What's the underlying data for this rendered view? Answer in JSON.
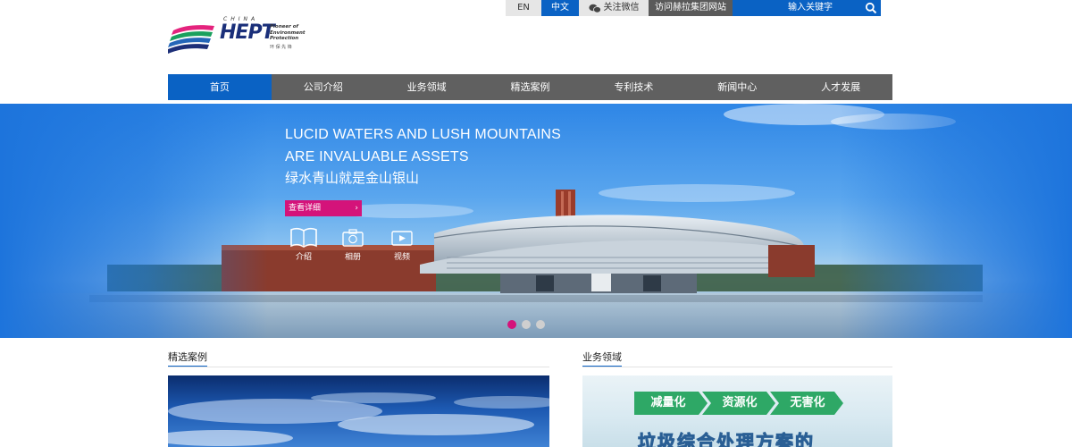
{
  "topbar": {
    "lang_en": "EN",
    "lang_zh": "中文",
    "wechat": "关注微信",
    "visit_group": "访问赫拉集团网站",
    "search_placeholder": "输入关键字"
  },
  "logo": {
    "country": "CHINA",
    "brand": "HEPT",
    "tagline_1": "Pioneer of",
    "tagline_2": "Environment Protection",
    "cn_name": "环 保 先 锋"
  },
  "nav": [
    {
      "label": "首页",
      "active": true
    },
    {
      "label": "公司介绍",
      "active": false
    },
    {
      "label": "业务领域",
      "active": false
    },
    {
      "label": "精选案例",
      "active": false
    },
    {
      "label": "专利技术",
      "active": false
    },
    {
      "label": "新闻中心",
      "active": false
    },
    {
      "label": "人才发展",
      "active": false
    }
  ],
  "hero": {
    "headline_1": "LUCID WATERS AND LUSH MOUNTAINS",
    "headline_2": "ARE INVALUABLE ASSETS",
    "headline_cn": "绿水青山就是金山银山",
    "more_button": "查看详细",
    "more_arrow": "›",
    "links": [
      {
        "label": "介绍",
        "icon": "book-icon"
      },
      {
        "label": "相册",
        "icon": "camera-icon"
      },
      {
        "label": "视频",
        "icon": "video-icon"
      }
    ],
    "slides": 3,
    "active_slide": 1
  },
  "sections": {
    "cases_title": "精选案例",
    "business_title": "业务领域",
    "business_tags": [
      "减量化",
      "资源化",
      "无害化"
    ],
    "business_banner": "垃圾综合处理方案的"
  },
  "colors": {
    "accent_blue": "#0a62c4",
    "nav_gray": "#606060",
    "magenta": "#d4137a"
  }
}
